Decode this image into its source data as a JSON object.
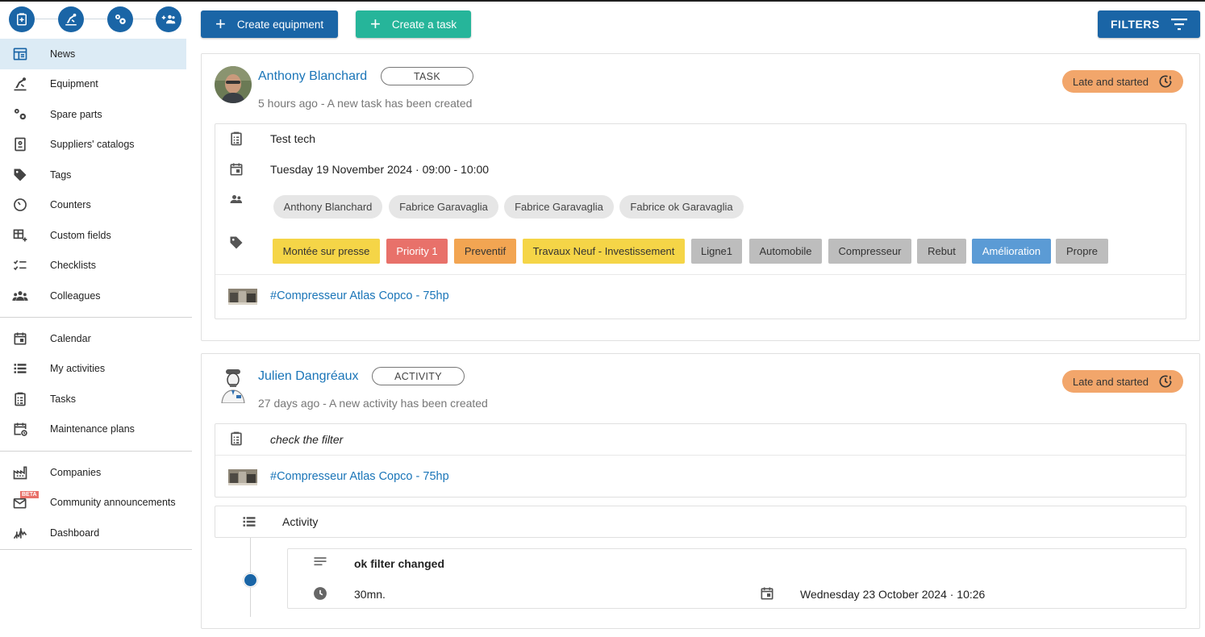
{
  "sidebar": {
    "quick_actions": [
      {
        "icon": "add-clipboard-icon"
      },
      {
        "icon": "equipment-icon"
      },
      {
        "icon": "gears-icon"
      },
      {
        "icon": "add-colleague-icon"
      }
    ],
    "groups": [
      [
        {
          "label": "News",
          "icon": "news-icon",
          "active": true
        },
        {
          "label": "Equipment",
          "icon": "equipment-icon"
        },
        {
          "label": "Spare parts",
          "icon": "spare-parts-icon"
        },
        {
          "label": "Suppliers' catalogs",
          "icon": "catalog-icon"
        },
        {
          "label": "Tags",
          "icon": "tag-icon"
        },
        {
          "label": "Counters",
          "icon": "counter-icon"
        },
        {
          "label": "Custom fields",
          "icon": "custom-fields-icon"
        },
        {
          "label": "Checklists",
          "icon": "checklist-icon"
        },
        {
          "label": "Colleagues",
          "icon": "colleagues-icon"
        }
      ],
      [
        {
          "label": "Calendar",
          "icon": "calendar-icon"
        },
        {
          "label": "My activities",
          "icon": "list-icon"
        },
        {
          "label": "Tasks",
          "icon": "tasks-icon"
        },
        {
          "label": "Maintenance plans",
          "icon": "maintenance-plan-icon"
        }
      ],
      [
        {
          "label": "Companies",
          "icon": "factory-icon"
        },
        {
          "label": "Community announcements",
          "icon": "announcement-icon",
          "badge": "BETA"
        },
        {
          "label": "Dashboard",
          "icon": "dashboard-icon"
        }
      ]
    ]
  },
  "toolbar": {
    "create_equipment": "Create equipment",
    "create_task": "Create a task",
    "filters": "FILTERS"
  },
  "feed": [
    {
      "author": "Anthony Blanchard",
      "type": "TASK",
      "subline": "5 hours ago - A new task has been created",
      "status": "Late and started",
      "title": "Test tech",
      "datetime": "Tuesday 19 November 2024 · 09:00 - 10:00",
      "assignees": [
        "Anthony Blanchard",
        "Fabrice Garavaglia",
        "Fabrice Garavaglia",
        "Fabrice ok Garavaglia"
      ],
      "tags": [
        {
          "label": "Montée sur presse",
          "color": "#f5d547",
          "text": "#333333"
        },
        {
          "label": "Priority 1",
          "color": "#e8716a",
          "text": "#ffffff"
        },
        {
          "label": "Preventif",
          "color": "#f2a552",
          "text": "#333333"
        },
        {
          "label": "Travaux Neuf - Investissement",
          "color": "#f5d547",
          "text": "#333333"
        },
        {
          "label": "Ligne1",
          "color": "#bdbdbd",
          "text": "#333333"
        },
        {
          "label": "Automobile",
          "color": "#bdbdbd",
          "text": "#333333"
        },
        {
          "label": "Compresseur",
          "color": "#bdbdbd",
          "text": "#333333"
        },
        {
          "label": "Rebut",
          "color": "#bdbdbd",
          "text": "#333333"
        },
        {
          "label": "Amélioration",
          "color": "#5b9bd5",
          "text": "#ffffff"
        },
        {
          "label": "Propre",
          "color": "#bdbdbd",
          "text": "#333333"
        }
      ],
      "equipment": "#Compresseur Atlas Copco - 75hp"
    },
    {
      "author": "Julien Dangréaux",
      "type": "ACTIVITY",
      "subline": "27 days ago - A new activity has been created",
      "status": "Late and started",
      "title": "check the filter",
      "equipment": "#Compresseur Atlas Copco - 75hp",
      "activity_header": "Activity",
      "activity": {
        "description": "ok filter changed",
        "duration": "30mn.",
        "datetime": "Wednesday 23 October 2024 · 10:26"
      }
    }
  ]
}
